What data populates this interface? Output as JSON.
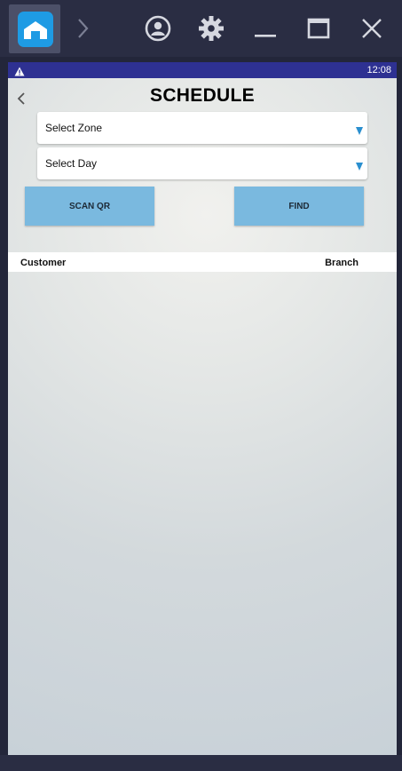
{
  "emulator": {
    "toolbar_icons": [
      "home-icon",
      "chevron-right-icon",
      "account-icon",
      "gear-icon",
      "minimize-icon",
      "maximize-icon",
      "close-icon"
    ],
    "accent_color": "#1e9be4"
  },
  "status_bar": {
    "time": "12:08",
    "left_icon": "warning-icon",
    "color": "#2e3192"
  },
  "header": {
    "back_icon": "chevron-left-icon",
    "title": "SCHEDULE"
  },
  "filters": {
    "zone": {
      "label": "Select Zone",
      "icon": "dropdown-caret-icon"
    },
    "day": {
      "label": "Select Day",
      "icon": "dropdown-caret-icon"
    }
  },
  "actions": {
    "scan_qr": "SCAN QR",
    "find": "FIND",
    "button_color": "#7ab9df"
  },
  "table": {
    "columns": [
      "Customer",
      "Branch"
    ],
    "rows": []
  }
}
